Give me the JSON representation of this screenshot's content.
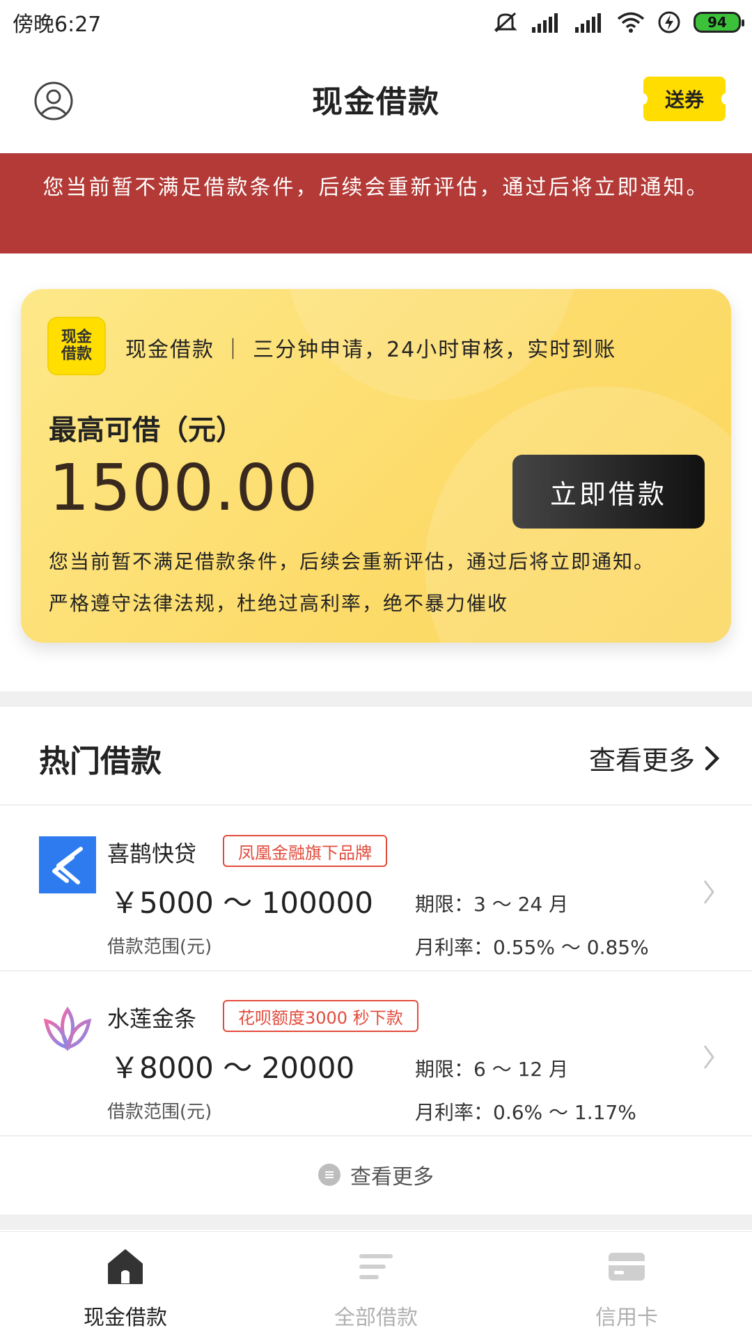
{
  "status_bar": {
    "time": "傍晚6:27",
    "battery": "94"
  },
  "header": {
    "title": "现金借款",
    "coupon": "送券"
  },
  "alert": {
    "text": "您当前暂不满足借款条件，后续会重新评估，通过后将立即通知。"
  },
  "card": {
    "logo_line1": "现金",
    "logo_line2": "借款",
    "brand": "现金借款 ｜ 三分钟申请，24小时审核，实时到账",
    "amount_label": "最高可借（元）",
    "amount": "1500.00",
    "borrow_button": "立即借款",
    "note1": "您当前暂不满足借款条件，后续会重新评估，通过后将立即通知。",
    "note2": "严格遵守法律法规，杜绝过高利率，绝不暴力催收"
  },
  "hot": {
    "title": "热门借款",
    "view_more": "查看更多",
    "items": [
      {
        "name": "喜鹊快贷",
        "tag": "凤凰金融旗下品牌",
        "range": "￥5000 ～ 100000",
        "range_label": "借款范围(元)",
        "term": "期限：3 ～ 24 月",
        "rate": "月利率：0.55% ～ 0.85%"
      },
      {
        "name": "水莲金条",
        "tag": "花呗额度3000 秒下款",
        "range": "￥8000 ～ 20000",
        "range_label": "借款范围(元)",
        "term": "期限：6 ～ 12 月",
        "rate": "月利率：0.6% ～ 1.17%"
      }
    ]
  },
  "more": {
    "label": "查看更多"
  },
  "nav": {
    "items": [
      {
        "label": "现金借款"
      },
      {
        "label": "全部借款"
      },
      {
        "label": "信用卡"
      }
    ]
  },
  "colors": {
    "accent": "#ffdd00",
    "alert": "#b33a36",
    "tag": "#e24b3c"
  }
}
